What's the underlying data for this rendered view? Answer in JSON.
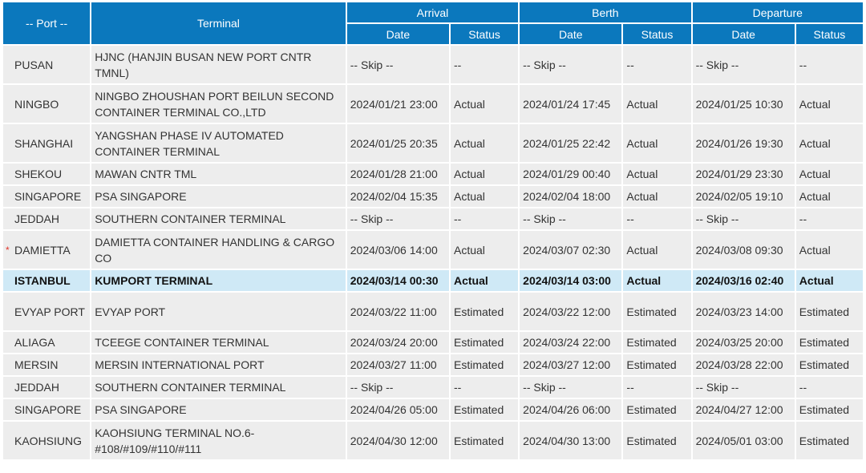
{
  "header": {
    "port": "-- Port --",
    "terminal": "Terminal",
    "arrival": "Arrival",
    "berth": "Berth",
    "departure": "Departure",
    "date": "Date",
    "status": "Status"
  },
  "rows": [
    {
      "port": "PUSAN",
      "marker": "",
      "terminal": "HJNC (HANJIN BUSAN NEW PORT CNTR TMNL)",
      "arrival_date": "-- Skip --",
      "arrival_status": "--",
      "berth_date": "-- Skip --",
      "berth_status": "--",
      "departure_date": "-- Skip --",
      "departure_status": "--"
    },
    {
      "port": "NINGBO",
      "marker": "",
      "terminal": "NINGBO ZHOUSHAN PORT BEILUN SECOND CONTAINER TERMINAL CO.,LTD",
      "arrival_date": "2024/01/21 23:00",
      "arrival_status": "Actual",
      "berth_date": "2024/01/24 17:45",
      "berth_status": "Actual",
      "departure_date": "2024/01/25 10:30",
      "departure_status": "Actual"
    },
    {
      "port": "SHANGHAI",
      "marker": "",
      "terminal": "YANGSHAN PHASE IV AUTOMATED CONTAINER TERMINAL",
      "arrival_date": "2024/01/25 20:35",
      "arrival_status": "Actual",
      "berth_date": "2024/01/25 22:42",
      "berth_status": "Actual",
      "departure_date": "2024/01/26 19:30",
      "departure_status": "Actual"
    },
    {
      "port": "SHEKOU",
      "marker": "",
      "terminal": "MAWAN CNTR TML",
      "arrival_date": "2024/01/28 21:00",
      "arrival_status": "Actual",
      "berth_date": "2024/01/29 00:40",
      "berth_status": "Actual",
      "departure_date": "2024/01/29 23:30",
      "departure_status": "Actual"
    },
    {
      "port": "SINGAPORE",
      "marker": "",
      "terminal": "PSA SINGAPORE",
      "arrival_date": "2024/02/04 15:35",
      "arrival_status": "Actual",
      "berth_date": "2024/02/04 18:00",
      "berth_status": "Actual",
      "departure_date": "2024/02/05 19:10",
      "departure_status": "Actual"
    },
    {
      "port": "JEDDAH",
      "marker": "",
      "terminal": "SOUTHERN CONTAINER TERMINAL",
      "arrival_date": "-- Skip --",
      "arrival_status": "--",
      "berth_date": "-- Skip --",
      "berth_status": "--",
      "departure_date": "-- Skip --",
      "departure_status": "--"
    },
    {
      "port": "DAMIETTA",
      "marker": "*",
      "terminal": "DAMIETTA CONTAINER HANDLING & CARGO CO",
      "arrival_date": "2024/03/06 14:00",
      "arrival_status": "Actual",
      "berth_date": "2024/03/07 02:30",
      "berth_status": "Actual",
      "departure_date": "2024/03/08 09:30",
      "departure_status": "Actual"
    },
    {
      "port": "ISTANBUL",
      "marker": "",
      "terminal": "KUMPORT TERMINAL",
      "arrival_date": "2024/03/14 00:30",
      "arrival_status": "Actual",
      "berth_date": "2024/03/14 03:00",
      "berth_status": "Actual",
      "departure_date": "2024/03/16 02:40",
      "departure_status": "Actual"
    },
    {
      "port": "EVYAP PORT",
      "marker": "",
      "terminal": "EVYAP PORT",
      "arrival_date": "2024/03/22 11:00",
      "arrival_status": "Estimated",
      "berth_date": "2024/03/22 12:00",
      "berth_status": "Estimated",
      "departure_date": "2024/03/23 14:00",
      "departure_status": "Estimated"
    },
    {
      "port": "ALIAGA",
      "marker": "",
      "terminal": "TCEEGE CONTAINER TERMINAL",
      "arrival_date": "2024/03/24 20:00",
      "arrival_status": "Estimated",
      "berth_date": "2024/03/24 22:00",
      "berth_status": "Estimated",
      "departure_date": "2024/03/25 20:00",
      "departure_status": "Estimated"
    },
    {
      "port": "MERSIN",
      "marker": "",
      "terminal": "MERSIN INTERNATIONAL PORT",
      "arrival_date": "2024/03/27 11:00",
      "arrival_status": "Estimated",
      "berth_date": "2024/03/27 12:00",
      "berth_status": "Estimated",
      "departure_date": "2024/03/28 22:00",
      "departure_status": "Estimated"
    },
    {
      "port": "JEDDAH",
      "marker": "",
      "terminal": "SOUTHERN CONTAINER TERMINAL",
      "arrival_date": "-- Skip --",
      "arrival_status": "--",
      "berth_date": "-- Skip --",
      "berth_status": "--",
      "departure_date": "-- Skip --",
      "departure_status": "--"
    },
    {
      "port": "SINGAPORE",
      "marker": "",
      "terminal": "PSA SINGAPORE",
      "arrival_date": "2024/04/26 05:00",
      "arrival_status": "Estimated",
      "berth_date": "2024/04/26 06:00",
      "berth_status": "Estimated",
      "departure_date": "2024/04/27 12:00",
      "departure_status": "Estimated"
    },
    {
      "port": "KAOHSIUNG",
      "marker": "",
      "terminal": "KAOHSIUNG TERMINAL NO.6-#108/#109/#110/#111",
      "arrival_date": "2024/04/30 12:00",
      "arrival_status": "Estimated",
      "berth_date": "2024/04/30 13:00",
      "berth_status": "Estimated",
      "departure_date": "2024/05/01 03:00",
      "departure_status": "Estimated"
    }
  ]
}
